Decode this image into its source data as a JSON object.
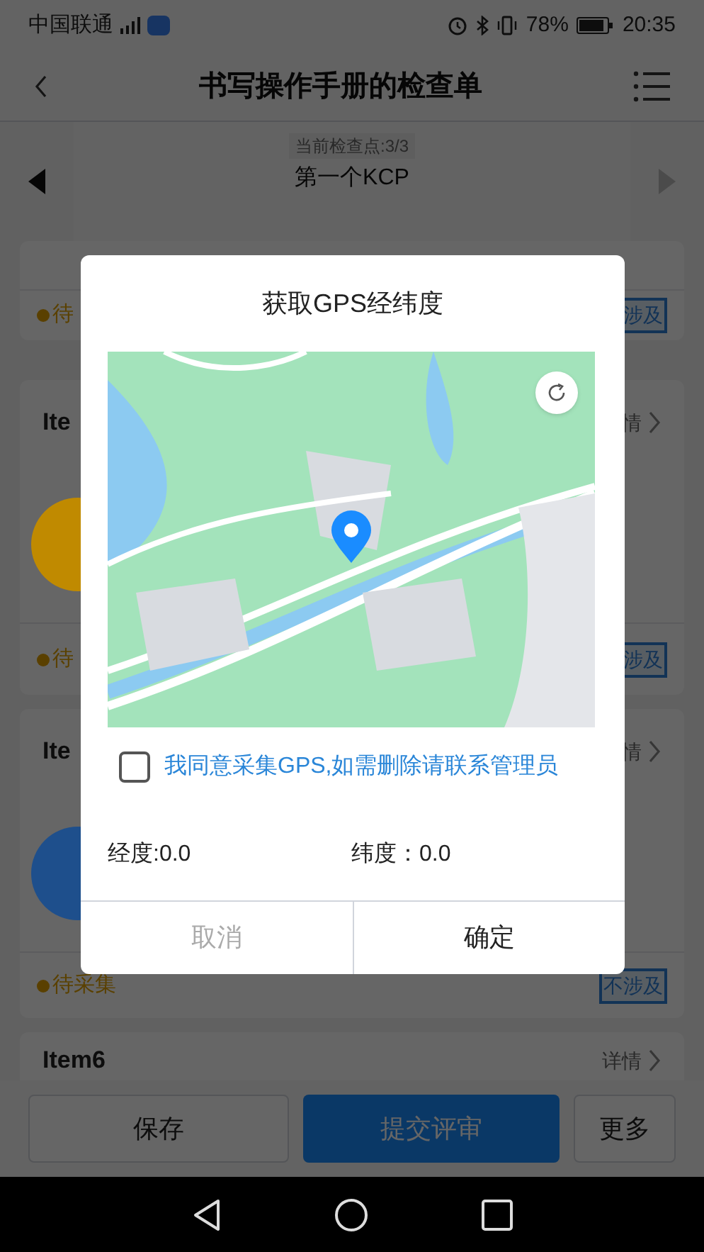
{
  "status_bar": {
    "carrier": "中国联通",
    "battery": "78%",
    "time": "20:35"
  },
  "header": {
    "title": "书写操作手册的检查单"
  },
  "checkpoint": {
    "counter": "当前检查点:3/3",
    "name": "第一个KCP",
    "prev_disabled": false,
    "next_disabled": true
  },
  "cards": [
    {
      "status": "待",
      "action": "涉及"
    },
    {
      "title": "Ite",
      "link": "情",
      "color": "#c08a00",
      "status": "待",
      "action": "涉及"
    },
    {
      "title": "Ite",
      "link": "情",
      "color": "#1e4f8c",
      "status": "待采集",
      "action": "不涉及"
    },
    {
      "title": "Item6",
      "link": "详情"
    }
  ],
  "dialog": {
    "title": "获取GPS经纬度",
    "consent": {
      "text": "我同意采集GPS,如需删除请联系管理员",
      "checked": false
    },
    "longitude": "经度:0.0",
    "latitude": "纬度：0.0",
    "buttons": [
      {
        "label": "取消",
        "disabled": true
      },
      {
        "label": "确定",
        "disabled": false
      }
    ]
  },
  "bottom_buttons": [
    {
      "label": "保存",
      "kind": "outline"
    },
    {
      "label": "提交评审",
      "kind": "primary"
    },
    {
      "label": "更多",
      "kind": "outline"
    }
  ]
}
